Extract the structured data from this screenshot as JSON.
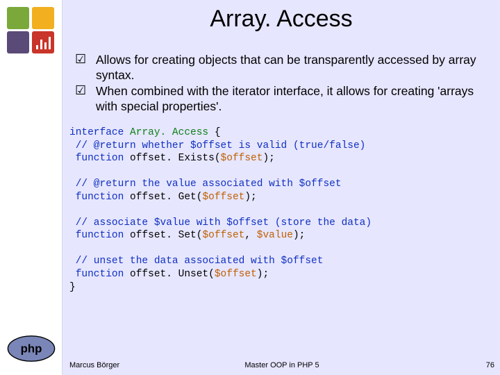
{
  "title": "Array. Access",
  "bullets": [
    "Allows for creating objects that can be transparently accessed by array syntax.",
    "When combined with the iterator interface, it allows for creating 'arrays with special properties'."
  ],
  "checkmark": "☑",
  "code": {
    "line1_kw": "interface ",
    "line1_typ": "Array. Access ",
    "line1_rest": "{",
    "line2": " // @return whether $offset is valid (true/false)",
    "line3_kw": " function ",
    "line3_fn": "offset. Exists",
    "line3_open": "(",
    "line3_var": "$offset",
    "line3_close": ");",
    "line5": " // @return the value associated with $offset",
    "line6_kw": " function ",
    "line6_fn": "offset. Get",
    "line6_open": "(",
    "line6_var": "$offset",
    "line6_close": ");",
    "line8": " // associate $value with $offset (store the data)",
    "line9_kw": " function ",
    "line9_fn": "offset. Set",
    "line9_open": "(",
    "line9_var1": "$offset",
    "line9_comma": ", ",
    "line9_var2": "$value",
    "line9_close": ");",
    "line11": " // unset the data associated with $offset",
    "line12_kw": " function ",
    "line12_fn": "offset. Unset",
    "line12_open": "(",
    "line12_var": "$offset",
    "line12_close": ");",
    "line13": "}"
  },
  "footer": {
    "left": "Marcus Börger",
    "center": "Master OOP in PHP 5",
    "right": "76"
  }
}
